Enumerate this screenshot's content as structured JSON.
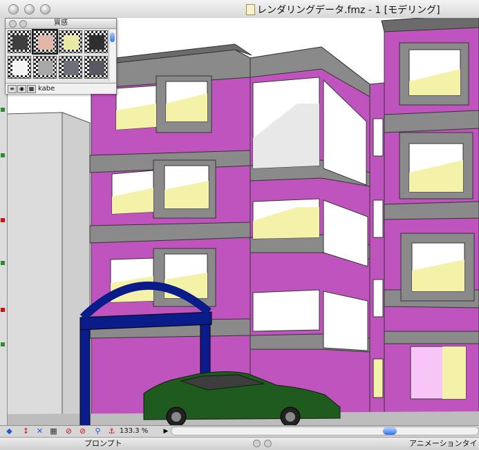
{
  "window": {
    "title": "レンダリングデータ.fmz - 1 [モデリング]"
  },
  "material_palette": {
    "title": "質感",
    "selected_material": "kabe",
    "swatches": [
      {
        "name": "dark-gray",
        "color": "#3f3f3f"
      },
      {
        "name": "pink-beige",
        "color": "#e3b6aa"
      },
      {
        "name": "pale-yellow",
        "color": "#e9e9a6"
      },
      {
        "name": "charcoal",
        "color": "#2f2f2f"
      },
      {
        "name": "white",
        "color": "#f4f4f4"
      },
      {
        "name": "light-gray",
        "color": "#a8a8a8"
      },
      {
        "name": "steel",
        "color": "#6f6f7a"
      },
      {
        "name": "slate",
        "color": "#585863"
      }
    ]
  },
  "toolbar": {
    "zoom": "133.3 %"
  },
  "panels": {
    "prompt_label": "プロンプト",
    "animation_label": "アニメーションタイ"
  },
  "colors": {
    "wall": "#c054bf",
    "concrete": "#8a8a8a",
    "window_glass": "#f4f1a8",
    "arch": "#0a1b8a",
    "car": "#1f5a1f"
  }
}
